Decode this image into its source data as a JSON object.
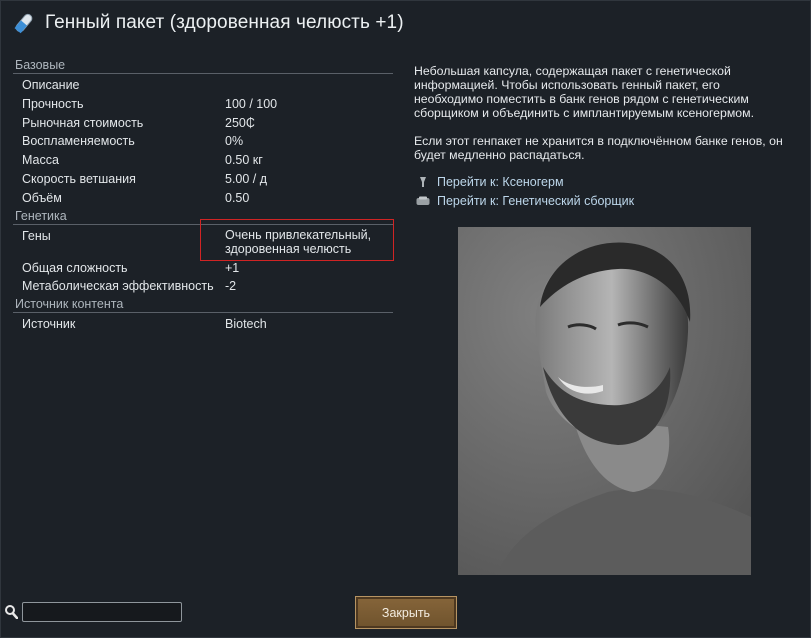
{
  "title": "Генный пакет (здоровенная челюсть +1)",
  "stats": {
    "base": {
      "header": "Базовые",
      "rows": [
        {
          "label": "Описание",
          "value": ""
        },
        {
          "label": "Прочность",
          "value": "100 / 100"
        },
        {
          "label": "Рыночная стоимость",
          "value": "250₵"
        },
        {
          "label": "Воспламеняемость",
          "value": "0%"
        },
        {
          "label": "Масса",
          "value": "0.50 кг"
        },
        {
          "label": "Скорость ветшания",
          "value": "5.00 / д"
        },
        {
          "label": "Объём",
          "value": "0.50"
        }
      ]
    },
    "genetics": {
      "header": "Генетика",
      "genes_label": "Гены",
      "genes_line1": "Очень привлекательный,",
      "genes_line2": "здоровенная челюсть",
      "rows": [
        {
          "label": "Общая сложность",
          "value": "+1"
        },
        {
          "label": "Метаболическая эффективность",
          "value": "-2"
        }
      ]
    },
    "source": {
      "header": "Источник контента",
      "rows": [
        {
          "label": "Источник",
          "value": "Biotech"
        }
      ]
    }
  },
  "description": {
    "p1": "Небольшая капсула, содержащая пакет с генетической информацией. Чтобы использовать генный пакет, его необходимо поместить в банк генов рядом с генетическим сборщиком и объединить с имплантируемым ксеногермом.",
    "p2": "Если этот генпакет не хранится в подключённом банке генов, он будет медленно распадаться."
  },
  "links": [
    {
      "label": "Перейти к: Ксеногерм",
      "icon": "xenogerm-icon"
    },
    {
      "label": "Перейти к: Генетический сборщик",
      "icon": "gene-assembler-icon"
    }
  ],
  "search": {
    "placeholder": "",
    "value": ""
  },
  "close_label": "Закрыть",
  "colors": {
    "highlight": "#d02424",
    "link": "#bcd6ea",
    "button": "#7a5c33"
  }
}
